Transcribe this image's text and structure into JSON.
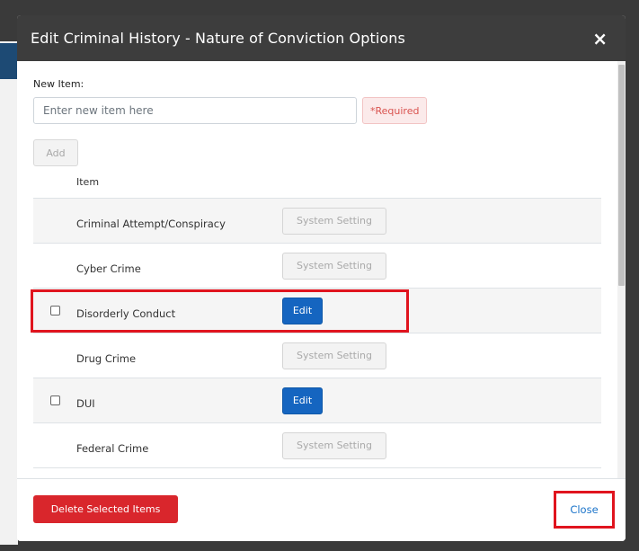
{
  "modal": {
    "title": "Edit Criminal History - Nature of Conviction Options",
    "close_icon": "×"
  },
  "form": {
    "label": "New Item:",
    "placeholder": "Enter new item here",
    "required": "*Required",
    "add_label": "Add"
  },
  "table": {
    "header_item": "Item",
    "rows": [
      {
        "name": "Criminal Attempt/Conspiracy",
        "action": "System Setting",
        "editable": false
      },
      {
        "name": "Cyber Crime",
        "action": "System Setting",
        "editable": false
      },
      {
        "name": "Disorderly Conduct",
        "action": "Edit",
        "editable": true
      },
      {
        "name": "Drug Crime",
        "action": "System Setting",
        "editable": false
      },
      {
        "name": "DUI",
        "action": "Edit",
        "editable": true
      },
      {
        "name": "Federal Crime",
        "action": "System Setting",
        "editable": false
      }
    ]
  },
  "footer": {
    "delete_label": "Delete Selected Items",
    "close_label": "Close"
  },
  "colors": {
    "header_bg": "#3d3d3d",
    "edit_blue": "#1565c0",
    "delete_red": "#d9262c",
    "highlight_red": "#e0141e"
  }
}
